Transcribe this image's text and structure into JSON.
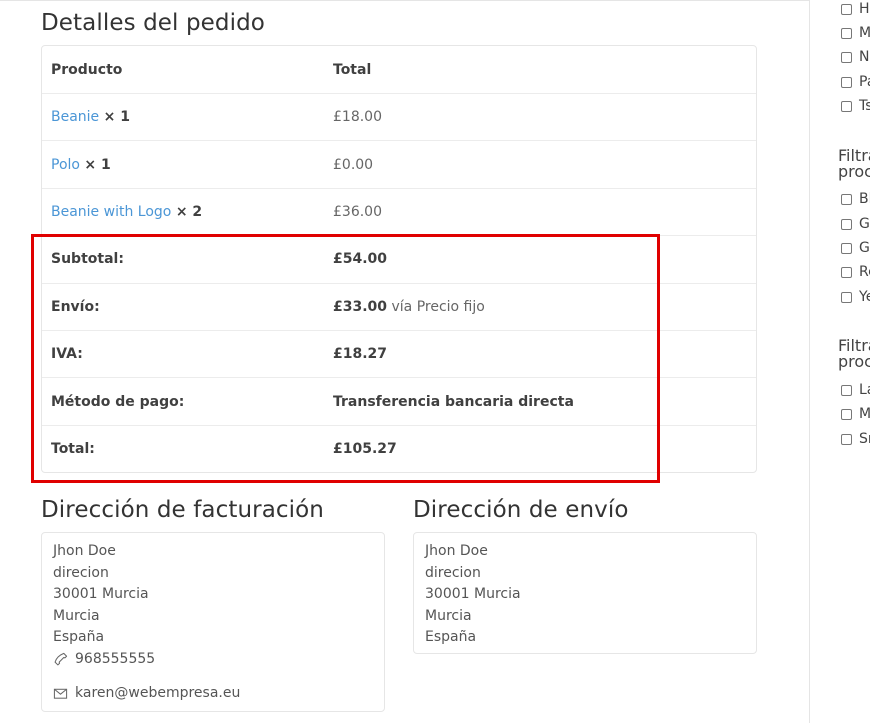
{
  "order": {
    "title": "Detalles del pedido",
    "header": {
      "product": "Producto",
      "total": "Total"
    },
    "items": [
      {
        "name": "Beanie",
        "qty": "× 1",
        "total": "£18.00"
      },
      {
        "name": "Polo",
        "qty": "× 1",
        "total": "£0.00"
      },
      {
        "name": "Beanie with Logo",
        "qty": "× 2",
        "total": "£36.00"
      }
    ],
    "summary": {
      "subtotal_label": "Subtotal:",
      "subtotal_value": "£54.00",
      "shipping_label": "Envío:",
      "shipping_value": "£33.00",
      "shipping_method": "vía Precio fijo",
      "tax_label": "IVA:",
      "tax_value": "£18.27",
      "payment_label": "Método de pago:",
      "payment_value": "Transferencia bancaria directa",
      "total_label": "Total:",
      "total_value": "£105.27"
    }
  },
  "billing": {
    "title": "Dirección de facturación",
    "name": "Jhon Doe",
    "address": "direcion",
    "postcode_city": "30001 Murcia",
    "state": "Murcia",
    "country": "España",
    "phone": "968555555",
    "email": "karen@webempresa.eu"
  },
  "shipping": {
    "title": "Dirección de envío",
    "name": "Jhon Doe",
    "address": "direcion",
    "postcode_city": "30001 Murcia",
    "state": "Murcia",
    "country": "España"
  },
  "sidebar": {
    "group1": [
      "Ho",
      "M",
      "N",
      "Pa",
      "Ts"
    ],
    "heading2_line1": "Filtra",
    "heading2_line2": "proc",
    "group2": [
      "Bl",
      "Gr",
      "Gr",
      "Re",
      "Ye"
    ],
    "heading3_line1": "Filtra",
    "heading3_line2": "proc",
    "group3": [
      "La",
      "M",
      "Sr"
    ]
  },
  "colors": {
    "link": "#4b96d6",
    "highlight": "#e00000",
    "border": "#e6e6e6"
  },
  "icons": {
    "phone": "phone-icon",
    "email": "envelope-icon"
  }
}
